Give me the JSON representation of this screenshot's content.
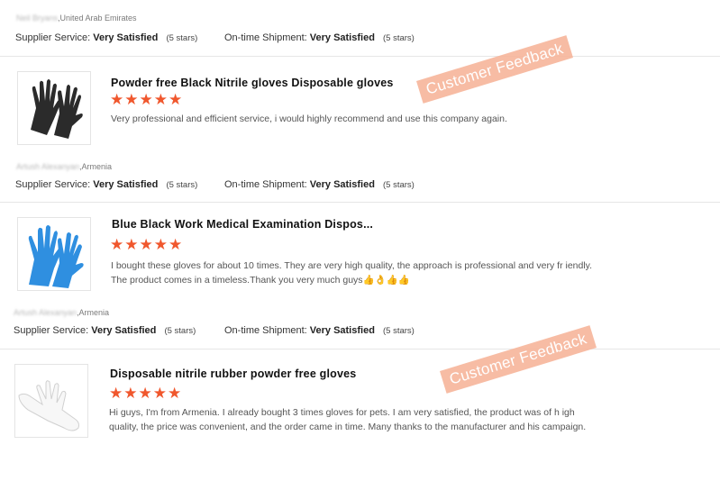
{
  "reviews": [
    {
      "reviewer": {
        "name_blurred": "Neil Bryans",
        "country": ",United Arab Emirates"
      },
      "supplier_label": "Supplier Service:",
      "supplier_value": "Very Satisfied",
      "supplier_stars": "(5 stars)",
      "shipment_label": "On-time Shipment:",
      "shipment_value": "Very Satisfied",
      "shipment_stars": "(5 stars)",
      "product_title": "Powder free Black Nitrile gloves Disposable gloves",
      "stars": "★★★★★",
      "review_text": "Very professional and efficient service, i would highly recommend and use this company again.",
      "thumb_icon": "black-glove-icon",
      "thumb_color": "#2b2b2b"
    },
    {
      "reviewer": {
        "name_blurred": "Artush Alexanyan",
        "country": ",Armenia"
      },
      "supplier_label": "Supplier Service:",
      "supplier_value": "Very Satisfied",
      "supplier_stars": "(5 stars)",
      "shipment_label": "On-time Shipment:",
      "shipment_value": "Very Satisfied",
      "shipment_stars": "(5 stars)",
      "product_title": "Blue Black Work Medical Examination Dispos...",
      "stars": "★★★★★",
      "review_text": "I bought these gloves for about 10 times. They are very high quality, the approach is professional and very fr iendly. The product comes in a timeless.Thank you very much guys👍👌👍👍",
      "thumb_icon": "blue-glove-icon",
      "thumb_color": "#2f8fe0"
    },
    {
      "reviewer": {
        "name_blurred": "Artush Alexanyan",
        "country": ",Armenia"
      },
      "supplier_label": "Supplier Service:",
      "supplier_value": "Very Satisfied",
      "supplier_stars": "(5 stars)",
      "shipment_label": "On-time Shipment:",
      "shipment_value": "Very Satisfied",
      "shipment_stars": "(5 stars)",
      "product_title": "Disposable nitrile rubber powder free gloves",
      "stars": "★★★★★",
      "review_text": "Hi guys, I'm from Armenia. I already bought 3 times gloves for pets. I am very satisfied, the product was of h igh quality, the price was convenient, and the order came in time. Many thanks to the manufacturer and his campaign.",
      "thumb_icon": "white-glove-icon",
      "thumb_color": "#f4f4f4"
    }
  ],
  "stamps": [
    {
      "text": "Customer Feedback"
    },
    {
      "text": "Customer Feedback"
    }
  ],
  "colors": {
    "accent": "#f0572d",
    "stamp_bg": "#f7b79d"
  }
}
